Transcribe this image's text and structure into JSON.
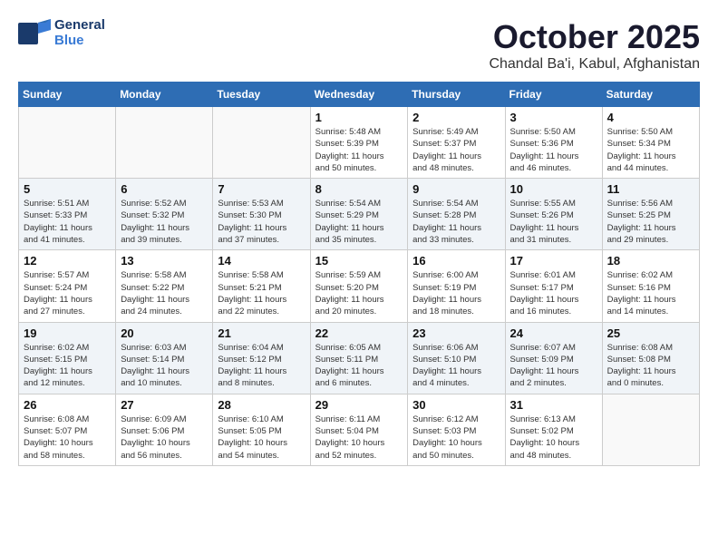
{
  "logo": {
    "line1": "General",
    "line2": "Blue"
  },
  "header": {
    "month": "October 2025",
    "location": "Chandal Ba'i, Kabul, Afghanistan"
  },
  "weekdays": [
    "Sunday",
    "Monday",
    "Tuesday",
    "Wednesday",
    "Thursday",
    "Friday",
    "Saturday"
  ],
  "weeks": [
    [
      {
        "day": "",
        "info": ""
      },
      {
        "day": "",
        "info": ""
      },
      {
        "day": "",
        "info": ""
      },
      {
        "day": "1",
        "info": "Sunrise: 5:48 AM\nSunset: 5:39 PM\nDaylight: 11 hours\nand 50 minutes."
      },
      {
        "day": "2",
        "info": "Sunrise: 5:49 AM\nSunset: 5:37 PM\nDaylight: 11 hours\nand 48 minutes."
      },
      {
        "day": "3",
        "info": "Sunrise: 5:50 AM\nSunset: 5:36 PM\nDaylight: 11 hours\nand 46 minutes."
      },
      {
        "day": "4",
        "info": "Sunrise: 5:50 AM\nSunset: 5:34 PM\nDaylight: 11 hours\nand 44 minutes."
      }
    ],
    [
      {
        "day": "5",
        "info": "Sunrise: 5:51 AM\nSunset: 5:33 PM\nDaylight: 11 hours\nand 41 minutes."
      },
      {
        "day": "6",
        "info": "Sunrise: 5:52 AM\nSunset: 5:32 PM\nDaylight: 11 hours\nand 39 minutes."
      },
      {
        "day": "7",
        "info": "Sunrise: 5:53 AM\nSunset: 5:30 PM\nDaylight: 11 hours\nand 37 minutes."
      },
      {
        "day": "8",
        "info": "Sunrise: 5:54 AM\nSunset: 5:29 PM\nDaylight: 11 hours\nand 35 minutes."
      },
      {
        "day": "9",
        "info": "Sunrise: 5:54 AM\nSunset: 5:28 PM\nDaylight: 11 hours\nand 33 minutes."
      },
      {
        "day": "10",
        "info": "Sunrise: 5:55 AM\nSunset: 5:26 PM\nDaylight: 11 hours\nand 31 minutes."
      },
      {
        "day": "11",
        "info": "Sunrise: 5:56 AM\nSunset: 5:25 PM\nDaylight: 11 hours\nand 29 minutes."
      }
    ],
    [
      {
        "day": "12",
        "info": "Sunrise: 5:57 AM\nSunset: 5:24 PM\nDaylight: 11 hours\nand 27 minutes."
      },
      {
        "day": "13",
        "info": "Sunrise: 5:58 AM\nSunset: 5:22 PM\nDaylight: 11 hours\nand 24 minutes."
      },
      {
        "day": "14",
        "info": "Sunrise: 5:58 AM\nSunset: 5:21 PM\nDaylight: 11 hours\nand 22 minutes."
      },
      {
        "day": "15",
        "info": "Sunrise: 5:59 AM\nSunset: 5:20 PM\nDaylight: 11 hours\nand 20 minutes."
      },
      {
        "day": "16",
        "info": "Sunrise: 6:00 AM\nSunset: 5:19 PM\nDaylight: 11 hours\nand 18 minutes."
      },
      {
        "day": "17",
        "info": "Sunrise: 6:01 AM\nSunset: 5:17 PM\nDaylight: 11 hours\nand 16 minutes."
      },
      {
        "day": "18",
        "info": "Sunrise: 6:02 AM\nSunset: 5:16 PM\nDaylight: 11 hours\nand 14 minutes."
      }
    ],
    [
      {
        "day": "19",
        "info": "Sunrise: 6:02 AM\nSunset: 5:15 PM\nDaylight: 11 hours\nand 12 minutes."
      },
      {
        "day": "20",
        "info": "Sunrise: 6:03 AM\nSunset: 5:14 PM\nDaylight: 11 hours\nand 10 minutes."
      },
      {
        "day": "21",
        "info": "Sunrise: 6:04 AM\nSunset: 5:12 PM\nDaylight: 11 hours\nand 8 minutes."
      },
      {
        "day": "22",
        "info": "Sunrise: 6:05 AM\nSunset: 5:11 PM\nDaylight: 11 hours\nand 6 minutes."
      },
      {
        "day": "23",
        "info": "Sunrise: 6:06 AM\nSunset: 5:10 PM\nDaylight: 11 hours\nand 4 minutes."
      },
      {
        "day": "24",
        "info": "Sunrise: 6:07 AM\nSunset: 5:09 PM\nDaylight: 11 hours\nand 2 minutes."
      },
      {
        "day": "25",
        "info": "Sunrise: 6:08 AM\nSunset: 5:08 PM\nDaylight: 11 hours\nand 0 minutes."
      }
    ],
    [
      {
        "day": "26",
        "info": "Sunrise: 6:08 AM\nSunset: 5:07 PM\nDaylight: 10 hours\nand 58 minutes."
      },
      {
        "day": "27",
        "info": "Sunrise: 6:09 AM\nSunset: 5:06 PM\nDaylight: 10 hours\nand 56 minutes."
      },
      {
        "day": "28",
        "info": "Sunrise: 6:10 AM\nSunset: 5:05 PM\nDaylight: 10 hours\nand 54 minutes."
      },
      {
        "day": "29",
        "info": "Sunrise: 6:11 AM\nSunset: 5:04 PM\nDaylight: 10 hours\nand 52 minutes."
      },
      {
        "day": "30",
        "info": "Sunrise: 6:12 AM\nSunset: 5:03 PM\nDaylight: 10 hours\nand 50 minutes."
      },
      {
        "day": "31",
        "info": "Sunrise: 6:13 AM\nSunset: 5:02 PM\nDaylight: 10 hours\nand 48 minutes."
      },
      {
        "day": "",
        "info": ""
      }
    ]
  ]
}
